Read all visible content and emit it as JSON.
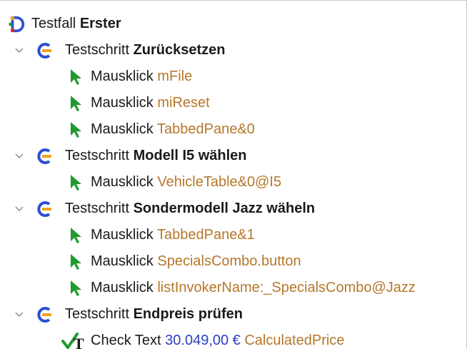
{
  "tree": {
    "root": {
      "keyword": "Testfall",
      "name": "Erster"
    },
    "steps": [
      {
        "keyword": "Testschritt",
        "name": "Zurücksetzen",
        "children": [
          {
            "keyword": "Mausklick",
            "target": "mFile"
          },
          {
            "keyword": "Mausklick",
            "target": "miReset"
          },
          {
            "keyword": "Mausklick",
            "target": "TabbedPane&0"
          }
        ]
      },
      {
        "keyword": "Testschritt",
        "name": "Modell I5 wählen",
        "children": [
          {
            "keyword": "Mausklick",
            "target": "VehicleTable&0@I5"
          }
        ]
      },
      {
        "keyword": "Testschritt",
        "name": "Sondermodell Jazz wäheln",
        "children": [
          {
            "keyword": "Mausklick",
            "target": "TabbedPane&1"
          },
          {
            "keyword": "Mausklick",
            "target": "SpecialsCombo.button"
          },
          {
            "keyword": "Mausklick",
            "target": "listInvokerName:_SpecialsCombo@Jazz"
          }
        ]
      },
      {
        "keyword": "Testschritt",
        "name": "Endpreis prüfen",
        "children": [
          {
            "keyword": "Check Text",
            "value": "30.049,00 €",
            "target": "CalculatedPrice"
          }
        ]
      }
    ]
  },
  "colors": {
    "component": "#b5772a",
    "value": "#2a3fc0",
    "step_icon_blue": "#2b4fd6",
    "step_icon_orange": "#f2a21d",
    "click_icon_green": "#1f9a2e"
  },
  "icons": {
    "root": "testcase-icon",
    "step": "teststep-icon",
    "click": "mouse-click-icon",
    "check": "check-text-icon",
    "expand": "chevron-down-icon"
  }
}
